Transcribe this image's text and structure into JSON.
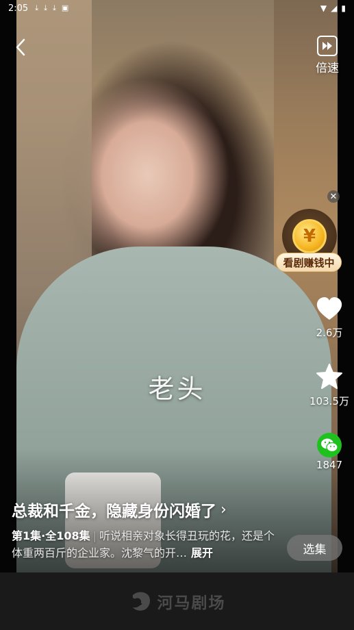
{
  "status_bar": {
    "time": "2:05"
  },
  "top": {
    "speed_label": "倍速"
  },
  "video": {
    "subtitle": "老头"
  },
  "promo": {
    "label": "看剧赚钱中",
    "coin_symbol": "¥"
  },
  "actions": {
    "like_count": "2.6万",
    "favorite_count": "103.5万",
    "share_count": "1847"
  },
  "drama": {
    "title": "总裁和千金，隐藏身份闪婚了",
    "episode_info": "第1集·全108集",
    "separator": "|",
    "description": "听说相亲对象长得丑玩的花，还是个体重两百斤的企业家。沈黎气的开…",
    "expand_label": "展开"
  },
  "select_button": "选集",
  "brand": {
    "name": "河马剧场"
  },
  "colors": {
    "wechat_green": "#1ec11e",
    "promo_gold": "#f6b622",
    "bottom_bar": "#1a1a1a"
  }
}
